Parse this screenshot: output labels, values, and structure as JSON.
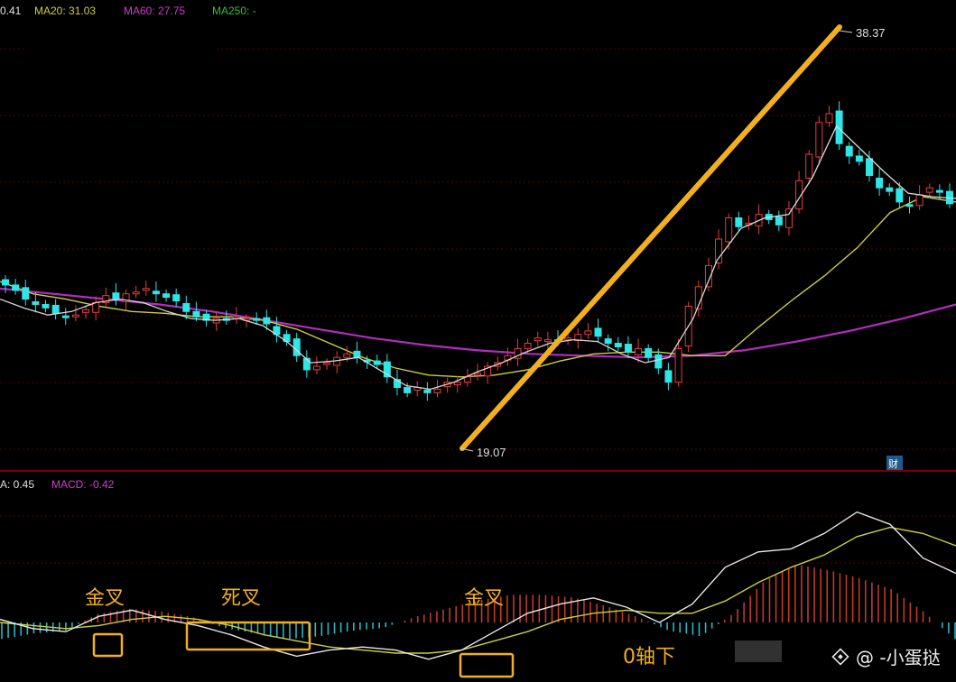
{
  "colors": {
    "background": "#000000",
    "up": "#e83c3c",
    "down": "#2ee6e6",
    "ma5": "#d8d8d8",
    "ma20": "#cfcf3c",
    "ma60": "#b42cc0",
    "ma250": "#34c034",
    "trend": "#f2b01e",
    "grid": "#5a0000",
    "annotation": "#f2b01e"
  },
  "header": {
    "ma5_value": "0.41",
    "ma20_label": "MA20: 31.03",
    "ma60_label": "MA60: 27.75",
    "ma250_label": "MA250: -"
  },
  "macd_header": {
    "dea_label": "A: 0.45",
    "macd_label": "MACD: -0.42"
  },
  "price_labels": {
    "high": "38.37",
    "low": "19.07"
  },
  "badge": "财",
  "annotations": {
    "golden_cross_1": "金叉",
    "death_cross": "死叉",
    "golden_cross_2": "金叉",
    "below_zero": "0轴下"
  },
  "watermark": {
    "text": "@ -小蛋挞",
    "logo_icon": "diamond-logo-icon"
  },
  "chart_data": [
    {
      "type": "candlestick",
      "title": "",
      "price_range": [
        17,
        41
      ],
      "low_point": 19.07,
      "high_point": 38.37,
      "candles_up_color": "#e83c3c",
      "candles_down_color": "#2ee6e6",
      "close": [
        26.4,
        26.1,
        25.6,
        25.3,
        25.1,
        24.8,
        24.6,
        24.7,
        25.0,
        25.4,
        25.8,
        25.6,
        25.9,
        26.0,
        26.2,
        25.9,
        25.7,
        25.5,
        24.9,
        24.6,
        24.4,
        24.5,
        24.4,
        24.6,
        24.5,
        24.4,
        24.2,
        23.6,
        23.2,
        22.4,
        21.6,
        21.8,
        22.0,
        22.3,
        22.5,
        22.3,
        22.1,
        21.9,
        21.2,
        20.6,
        20.3,
        20.6,
        20.3,
        20.5,
        20.9,
        20.9,
        21.2,
        21.4,
        21.8,
        22.0,
        22.4,
        22.8,
        23.1,
        23.4,
        23.3,
        23.2,
        23.4,
        23.6,
        23.8,
        23.5,
        23.1,
        22.9,
        22.6,
        22.8,
        22.3,
        21.7,
        20.9,
        22.8,
        25.2,
        26.3,
        27.5,
        29.0,
        30.2,
        29.7,
        29.9,
        30.4,
        30.1,
        29.8,
        30.7,
        32.3,
        33.8,
        35.6,
        36.1,
        34.4,
        33.7,
        33.4,
        32.6,
        31.9,
        31.7,
        31.1,
        30.9,
        31.5,
        31.9,
        31.7,
        31.0
      ],
      "ma5": [
        25.6,
        25.1,
        24.7,
        24.9,
        25.4,
        25.6,
        25.4,
        24.9,
        24.5,
        24.4,
        24.5,
        24.1,
        23.2,
        22.0,
        22.1,
        22.3,
        21.5,
        20.7,
        20.5,
        20.9,
        21.5,
        22.0,
        22.6,
        23.1,
        23.3,
        23.2,
        22.5,
        22.0,
        22.3,
        24.5,
        27.8,
        29.6,
        30.2,
        30.4,
        32.5,
        35.4,
        34.1,
        32.8,
        31.6,
        31.4,
        31.3
      ],
      "ma20": [
        26.6,
        25.9,
        25.6,
        25.2,
        24.9,
        24.8,
        24.6,
        24.6,
        24.4,
        23.9,
        23.1,
        22.3,
        21.7,
        21.3,
        21.2,
        21.3,
        21.6,
        22.1,
        22.5,
        22.6,
        22.6,
        22.4,
        22.4,
        24.0,
        25.5,
        26.9,
        28.5,
        30.5,
        31.4,
        31.1
      ],
      "ma60": [
        26.2,
        25.9,
        25.6,
        25.3,
        24.9,
        24.4,
        23.9,
        23.4,
        23.0,
        22.7,
        22.5,
        22.4,
        22.3,
        22.4,
        22.7,
        23.2,
        23.8,
        24.5,
        25.3
      ]
    },
    {
      "type": "macd",
      "title": "",
      "dif": [
        0.1,
        -0.2,
        -0.3,
        0.2,
        0.4,
        0.1,
        -0.1,
        -0.4,
        -0.8,
        -1.1,
        -0.9,
        -0.8,
        -0.9,
        -1.2,
        -0.9,
        -0.3,
        0.3,
        0.6,
        0.8,
        0.5,
        0.0,
        0.6,
        1.8,
        2.3,
        2.4,
        2.9,
        3.6,
        3.2,
        2.1,
        1.6
      ],
      "dea": [
        0.0,
        -0.1,
        -0.2,
        -0.1,
        0.1,
        0.2,
        0.1,
        -0.1,
        -0.4,
        -0.6,
        -0.8,
        -0.9,
        -1.0,
        -1.0,
        -0.9,
        -0.6,
        -0.3,
        0.1,
        0.3,
        0.4,
        0.3,
        0.3,
        0.7,
        1.3,
        1.8,
        2.2,
        2.8,
        3.1,
        2.9,
        2.5
      ],
      "hist": [
        -0.6,
        -0.4,
        -0.3,
        0.3,
        0.5,
        0.4,
        0.2,
        -0.2,
        -0.4,
        -0.6,
        -0.5,
        -0.3,
        -0.2,
        0.2,
        0.5,
        0.8,
        1.0,
        1.0,
        0.9,
        0.6,
        0.2,
        -0.3,
        -0.5,
        0.3,
        1.5,
        2.1,
        1.9,
        1.6,
        1.2,
        0.4,
        -0.6
      ]
    }
  ]
}
